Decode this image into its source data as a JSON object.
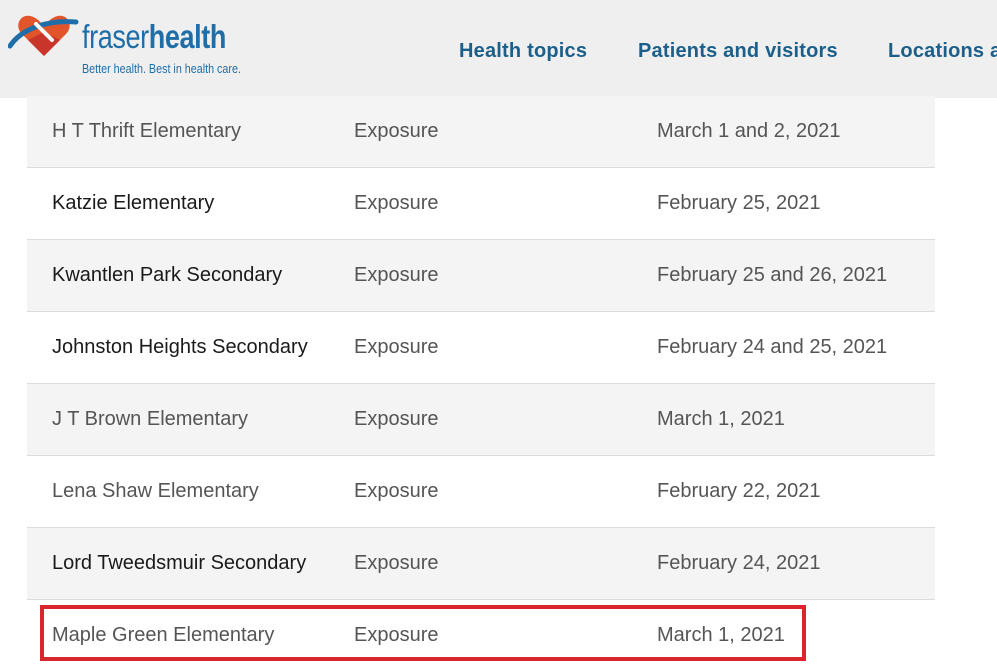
{
  "brand": {
    "name_light": "fraser",
    "name_bold": "health",
    "tagline": "Better health. Best in health care.",
    "colors": {
      "primary": "#1f6ea8",
      "heart_orange": "#e2552b",
      "heart_red": "#c8352a"
    }
  },
  "nav": {
    "items": [
      {
        "label": "Health topics"
      },
      {
        "label": "Patients and visitors"
      },
      {
        "label": "Locations a"
      }
    ]
  },
  "exposures": [
    {
      "school": "H T Thrift Elementary",
      "type": "Exposure",
      "dates": "March 1 and 2, 2021"
    },
    {
      "school": "Katzie Elementary",
      "type": "Exposure",
      "dates": "February 25, 2021"
    },
    {
      "school": "Kwantlen Park Secondary",
      "type": "Exposure",
      "dates": "February 25 and 26, 2021"
    },
    {
      "school": "Johnston Heights Secondary",
      "type": "Exposure",
      "dates": "February 24 and 25, 2021"
    },
    {
      "school": "J T Brown Elementary",
      "type": "Exposure",
      "dates": "March 1, 2021"
    },
    {
      "school": "Lena Shaw Elementary",
      "type": "Exposure",
      "dates": "February 22, 2021"
    },
    {
      "school": "Lord Tweedsmuir Secondary",
      "type": "Exposure",
      "dates": "February 24, 2021"
    },
    {
      "school": "Maple Green Elementary",
      "type": "Exposure",
      "dates": "March 1, 2021"
    }
  ],
  "highlight_color": "#d7262e"
}
